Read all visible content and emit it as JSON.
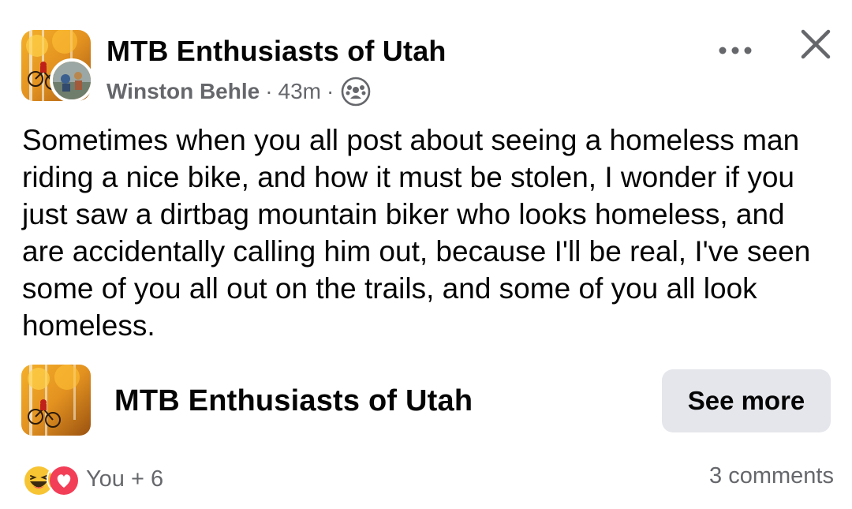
{
  "post": {
    "group_name": "MTB Enthusiasts of Utah",
    "author": "Winston Behle",
    "separator": "·",
    "time": "43m",
    "audience_icon": "group-members-icon",
    "body": "Sometimes when you all post about seeing a homeless man riding a nice bike, and how it must be stolen, I wonder if you just saw a dirtbag mountain biker who looks homeless, and are accidentally calling him out, because I'll be real, I've seen some of you all out on the trails, and some of you all look homeless."
  },
  "header_actions": {
    "more_icon": "more-horizontal-icon",
    "close_icon": "close-icon"
  },
  "group_card": {
    "name": "MTB Enthusiasts of Utah",
    "button_label": "See more"
  },
  "footer": {
    "reactions": [
      "haha-reaction-icon",
      "love-reaction-icon"
    ],
    "reaction_summary": "You + 6",
    "comments": "3 comments"
  },
  "colors": {
    "text_primary": "#050505",
    "text_secondary": "#65676b",
    "button_bg": "#e4e6eb",
    "haha_yellow": "#f7c433",
    "love_red": "#f33e58"
  }
}
